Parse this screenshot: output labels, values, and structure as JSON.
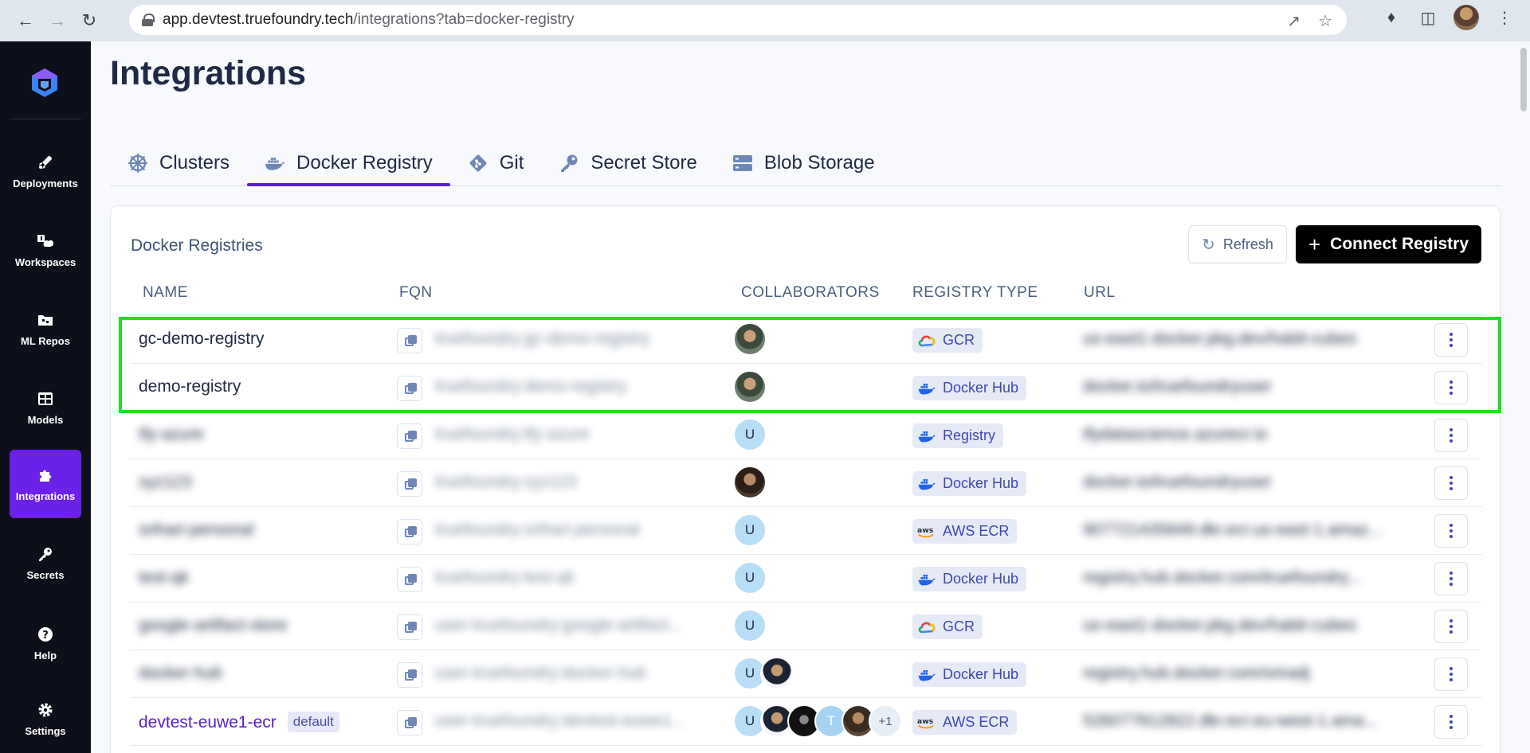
{
  "browser": {
    "url_host": "app.devtest.truefoundry.tech",
    "url_path": "/integrations?tab=docker-registry"
  },
  "sidebar": {
    "items": [
      {
        "label": "Deployments",
        "icon": "rocket-icon"
      },
      {
        "label": "Workspaces",
        "icon": "workspaces-icon"
      },
      {
        "label": "ML Repos",
        "icon": "folder-icon"
      },
      {
        "label": "Models",
        "icon": "grid-icon"
      },
      {
        "label": "Integrations",
        "icon": "puzzle-icon",
        "active": true
      },
      {
        "label": "Secrets",
        "icon": "key-icon"
      },
      {
        "label": "Help",
        "icon": "help-icon"
      },
      {
        "label": "Settings",
        "icon": "gear-icon"
      }
    ]
  },
  "page": {
    "title": "Integrations"
  },
  "tabs": [
    {
      "label": "Clusters",
      "icon": "helm-icon"
    },
    {
      "label": "Docker Registry",
      "icon": "docker-icon",
      "active": true
    },
    {
      "label": "Git",
      "icon": "git-icon"
    },
    {
      "label": "Secret Store",
      "icon": "key-icon"
    },
    {
      "label": "Blob Storage",
      "icon": "storage-icon"
    }
  ],
  "card": {
    "title": "Docker Registries",
    "refresh_label": "Refresh",
    "connect_label": "Connect Registry"
  },
  "table": {
    "columns": [
      "NAME",
      "FQN",
      "COLLABORATORS",
      "REGISTRY TYPE",
      "URL"
    ],
    "rows": [
      {
        "name": "gc-demo-registry",
        "fqn": "truefoundry:gc-demo-registry",
        "type": "GCR",
        "url": "us-east1-docker.pkg.dev/habit-cubes"
      },
      {
        "name": "demo-registry",
        "fqn": "truefoundry:demo-registry",
        "type": "Docker Hub",
        "url": "docker.io/truefoundryuser"
      },
      {
        "name": "tfy-azure",
        "fqn": "truefoundry:tfy-azure",
        "type": "Registry",
        "url": "tfydatascience.azurecr.io"
      },
      {
        "name": "xyz123",
        "fqn": "truefoundry:xyz123",
        "type": "Docker Hub",
        "url": "docker.io/truefoundryuser"
      },
      {
        "name": "srihari-personal",
        "fqn": "truefoundry:srihari-personal",
        "type": "AWS ECR",
        "url": "907721435849.dkr.ecr.us-east-1.amaz..."
      },
      {
        "name": "test-qk",
        "fqn": "truefoundry:test-qk",
        "type": "Docker Hub",
        "url": "registry.hub.docker.com/truefoundry..."
      },
      {
        "name": "google-artifact-store",
        "fqn": "user-truefoundry:google-artifact...",
        "type": "GCR",
        "url": "us-east1-docker.pkg.dev/habit-cubes"
      },
      {
        "name": "docker-hub",
        "fqn": "user-truefoundry:docker-hub",
        "type": "Docker Hub",
        "url": "registry.hub.docker.com/sriradj"
      },
      {
        "name": "devtest-euwe1-ecr",
        "badge": "default",
        "fqn": "user-truefoundry:devtest-euwe1...",
        "type": "AWS ECR",
        "url": "526077812822.dkr.ecr.eu-west-1.ama..."
      }
    ],
    "avatar_letters": {
      "u": "U",
      "t": "T",
      "more": "+1"
    }
  }
}
